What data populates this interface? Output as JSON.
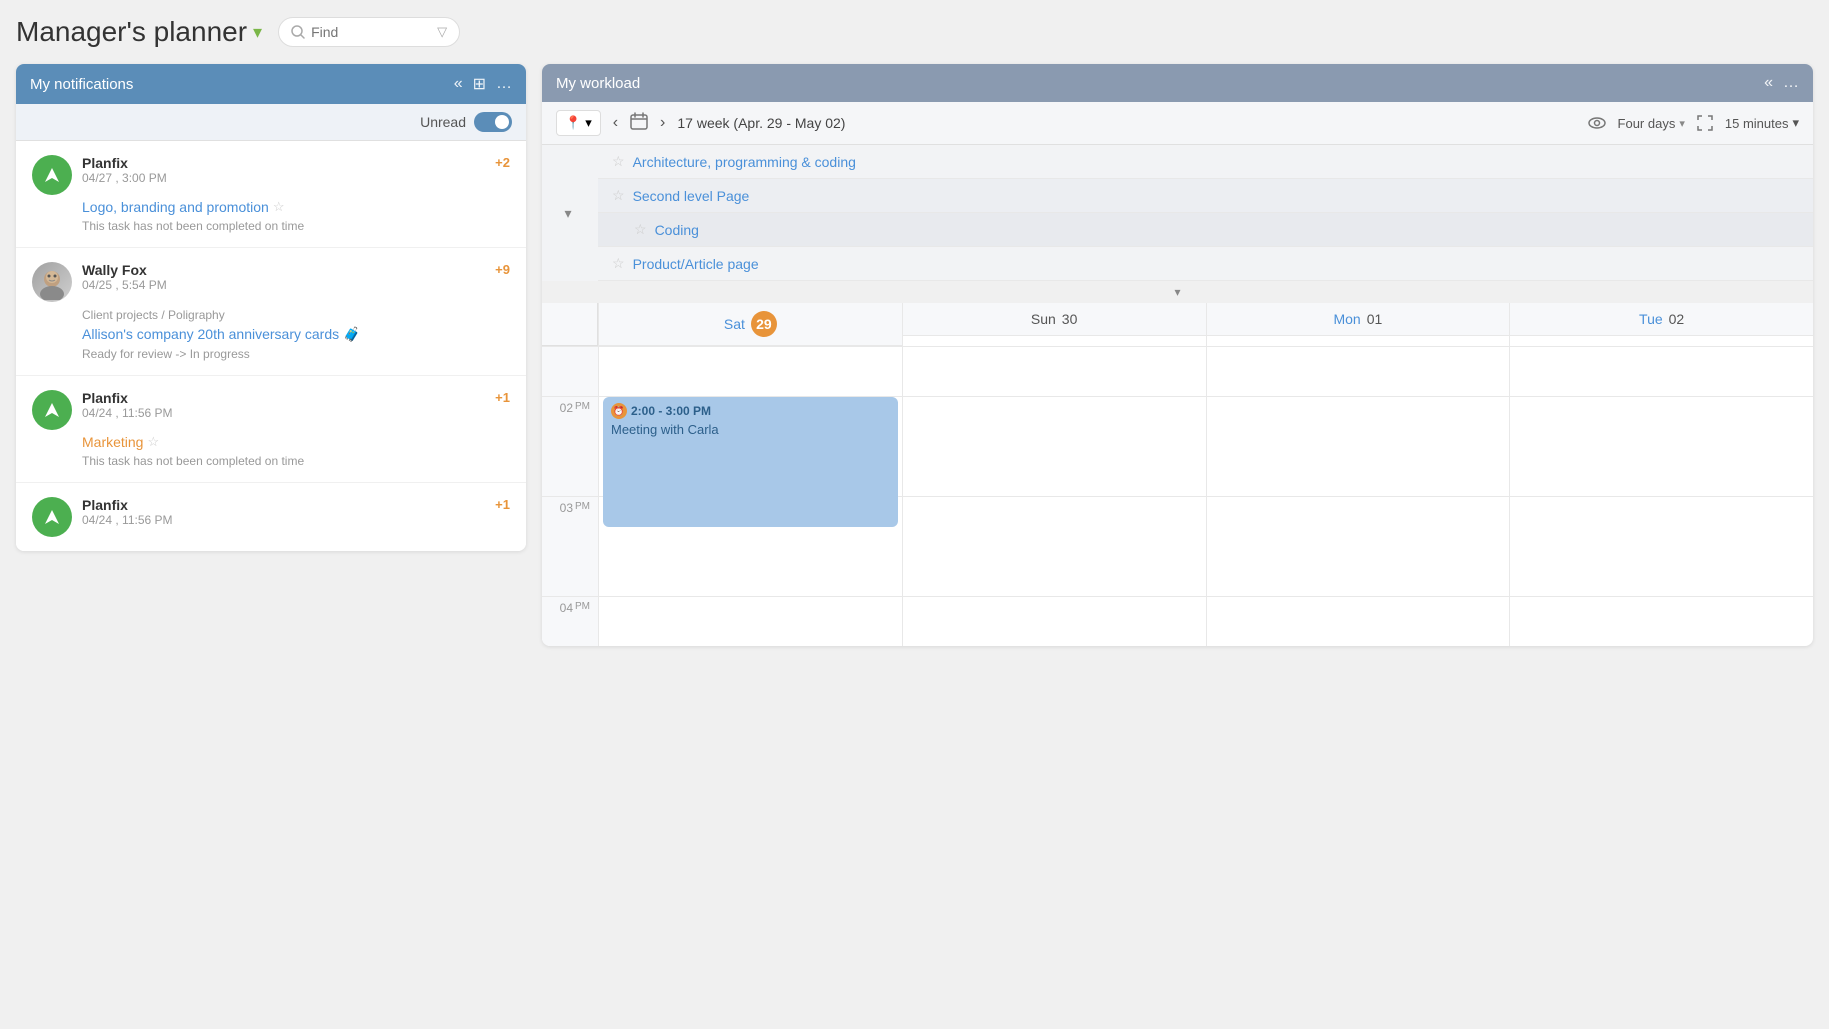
{
  "header": {
    "title": "Manager's planner",
    "chevron": "▾",
    "search_placeholder": "Find"
  },
  "notifications_panel": {
    "title": "My notifications",
    "unread_label": "Unread",
    "collapse_icon": "«",
    "grid_icon": "⊞",
    "more_icon": "…",
    "items": [
      {
        "sender": "Planfix",
        "time": "04/27 , 3:00 PM",
        "count": "+2",
        "task_title": "Logo, branding and promotion",
        "status": "This task has not been completed on time",
        "color": "blue",
        "avatar_type": "planfix"
      },
      {
        "sender": "Wally Fox",
        "time": "04/25 , 5:54 PM",
        "count": "+9",
        "breadcrumb": "Client projects / Poligraphy",
        "task_title": "Allison's company 20th anniversary cards 🧳",
        "status": "Ready for review -> In progress",
        "color": "blue",
        "avatar_type": "person"
      },
      {
        "sender": "Planfix",
        "time": "04/24 , 11:56 PM",
        "count": "+1",
        "task_title": "Marketing",
        "status": "This task has not been completed on time",
        "color": "orange",
        "avatar_type": "planfix"
      },
      {
        "sender": "Planfix",
        "time": "04/24 , 11:56 PM",
        "count": "+1",
        "task_title": "",
        "status": "",
        "color": "blue",
        "avatar_type": "planfix"
      }
    ]
  },
  "workload_panel": {
    "title": "My workload",
    "collapse_icon": "«",
    "more_icon": "…",
    "week_label": "17 week (Apr. 29 - May 02)",
    "view_mode": "Four days",
    "time_interval": "15 minutes",
    "tasks": [
      {
        "name": "Architecture, programming & coding",
        "level": 0
      },
      {
        "name": "Second level Page",
        "level": 0
      },
      {
        "name": "Coding",
        "level": 1
      },
      {
        "name": "Product/Article page",
        "level": 0
      }
    ],
    "days": [
      {
        "name": "Sat",
        "num": "29",
        "today": true
      },
      {
        "name": "Sun",
        "num": "30",
        "today": false
      },
      {
        "name": "Mon",
        "num": "01",
        "today": false
      },
      {
        "name": "Tue",
        "num": "02",
        "today": false
      }
    ],
    "time_slots": [
      {
        "hour": "02",
        "period": "PM"
      },
      {
        "hour": "03",
        "period": "PM"
      },
      {
        "hour": "04",
        "period": "PM"
      }
    ],
    "event": {
      "time_range": "2:00 - 3:00 PM",
      "title": "Meeting with Carla",
      "day_index": 0
    }
  }
}
